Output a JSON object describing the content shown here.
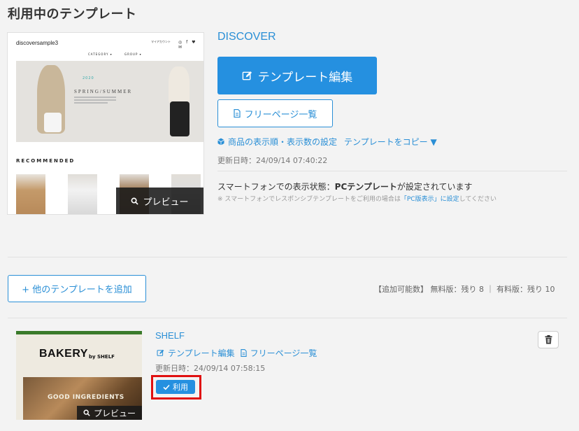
{
  "page_title": "利用中のテンプレート",
  "current_template": {
    "thumbnail": {
      "brand": "discoversample3",
      "header_text": "マイアカウント",
      "nav": [
        "CATEGORY ▾",
        "GROUP ▾"
      ],
      "year": "2020",
      "season": "SPRING/SUMMER",
      "section": "RECOMMENDED"
    },
    "preview_label": "プレビュー",
    "name": "DISCOVER",
    "edit_label": "テンプレート編集",
    "free_page_label": "フリーページ一覧",
    "sort_settings_label": "商品の表示順・表示数の設定",
    "copy_label": "テンプレートをコピー ▼",
    "updated": "更新日時：24/09/14 07:40:22",
    "smartphone_status_prefix": "スマートフォンでの表示状態：",
    "smartphone_status_value": "PCテンプレート",
    "smartphone_status_suffix": "が設定されています",
    "smartphone_note_prefix": "※ スマートフォンでレスポンシブテンプレートをご利用の場合は",
    "smartphone_note_link": "「PC版表示」に設定",
    "smartphone_note_suffix": "してください"
  },
  "add_template_label": "+ 他のテンプレートを追加",
  "quota_text": "【追加可能数】 無料版：残り 8 ｜ 有料版：残り 10",
  "other_templates": [
    {
      "thumbnail": {
        "brand": "BAKERY",
        "brand_sub": "by SHELF",
        "tagline": "GOOD INGREDIENTS"
      },
      "preview_label": "プレビュー",
      "name": "SHELF",
      "edit_label": "テンプレート編集",
      "free_page_label": "フリーページ一覧",
      "updated": "更新日時：24/09/14 07:58:15",
      "use_label": "利用"
    }
  ],
  "colors": {
    "accent": "#2590e0",
    "link": "#2a8fd6",
    "highlight": "#e01010"
  }
}
